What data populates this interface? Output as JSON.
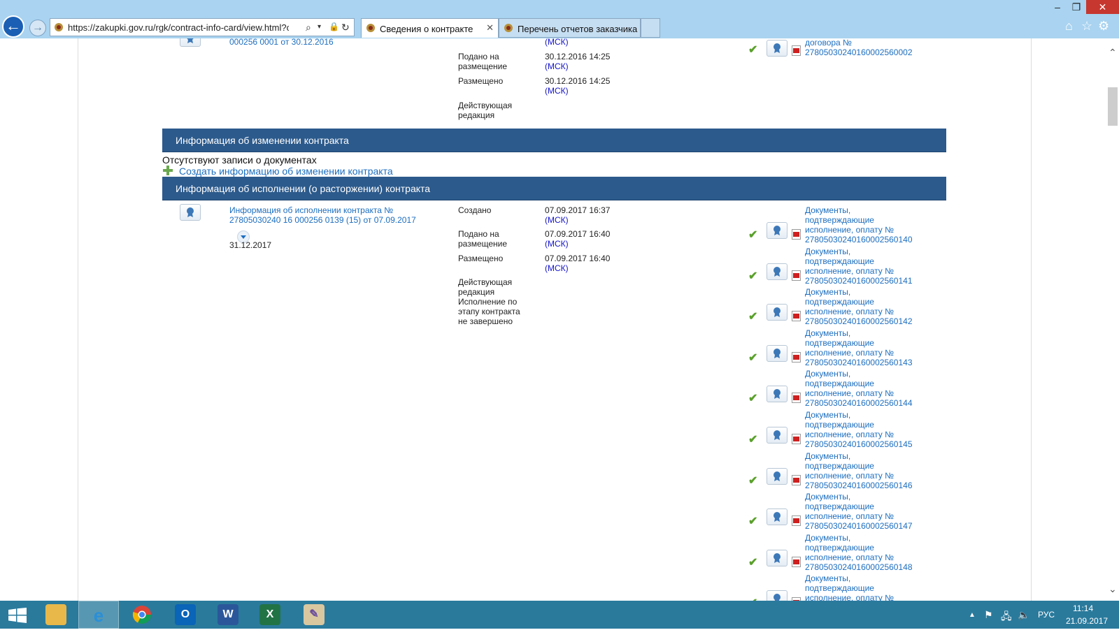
{
  "browser": {
    "url": "https://zakupki.gov.ru/rgk/contract-info-card/view.html?contrac",
    "tabs": [
      {
        "label": "Сведения о контракте"
      },
      {
        "label": "Перечень отчетов заказчика"
      }
    ],
    "tab_close_glyph": "✕",
    "window_controls": {
      "minimize": "–",
      "restore": "❐",
      "close": "✕"
    }
  },
  "page": {
    "top_block": {
      "contract_link_tail": "000256 0001 от 30.12.2016",
      "msk_1": "(МСК)",
      "rows": [
        {
          "label": "Подано на размещение",
          "value": "30.12.2016 14:25",
          "msk": "(МСК)"
        },
        {
          "label": "Размещено",
          "value": "30.12.2016 14:25",
          "msk": "(МСК)"
        },
        {
          "label": "Действующая редакция"
        }
      ],
      "doc_link_line1": "договора №",
      "doc_link_line2": "27805030240160002560002"
    },
    "change_section": {
      "title": "Информация об изменении контракта",
      "empty_note": "Отсутствуют записи о документах",
      "create_link": "Создать информацию об изменении контракта"
    },
    "execution_section": {
      "title": "Информация об исполнении (о расторжении) контракта",
      "record_link": "Информация об исполнении контракта № 27805030240 16 000256 0139 (15) от 07.09.2017",
      "record_date": "31.12.2017",
      "fields": [
        {
          "label": "Создано",
          "value": "07.09.2017 16:37",
          "msk": "(МСК)"
        },
        {
          "label": "Подано на размещение",
          "value": "07.09.2017 16:40",
          "msk": "(МСК)"
        },
        {
          "label": "Размещено",
          "value": "07.09.2017 16:40",
          "msk": "(МСК)"
        },
        {
          "label": "Действующая редакция"
        },
        {
          "label": "Исполнение по этапу контракта не завершено"
        }
      ],
      "documents": [
        {
          "l1": "Документы,",
          "l2": "подтверждающие",
          "l3": "исполнение, оплату №",
          "num": "27805030240160002560140"
        },
        {
          "l1": "Документы,",
          "l2": "подтверждающие",
          "l3": "исполнение, оплату №",
          "num": "27805030240160002560141"
        },
        {
          "l1": "Документы,",
          "l2": "подтверждающие",
          "l3": "исполнение, оплату №",
          "num": "27805030240160002560142"
        },
        {
          "l1": "Документы,",
          "l2": "подтверждающие",
          "l3": "исполнение, оплату №",
          "num": "27805030240160002560143"
        },
        {
          "l1": "Документы,",
          "l2": "подтверждающие",
          "l3": "исполнение, оплату №",
          "num": "27805030240160002560144"
        },
        {
          "l1": "Документы,",
          "l2": "подтверждающие",
          "l3": "исполнение, оплату №",
          "num": "27805030240160002560145"
        },
        {
          "l1": "Документы,",
          "l2": "подтверждающие",
          "l3": "исполнение, оплату №",
          "num": "27805030240160002560146"
        },
        {
          "l1": "Документы,",
          "l2": "подтверждающие",
          "l3": "исполнение, оплату №",
          "num": "27805030240160002560147"
        },
        {
          "l1": "Документы,",
          "l2": "подтверждающие",
          "l3": "исполнение, оплату №",
          "num": "27805030240160002560148"
        },
        {
          "l1": "Документы,",
          "l2": "подтверждающие",
          "l3": "исполнение, оплату №",
          "num": ""
        }
      ]
    }
  },
  "taskbar": {
    "apps": [
      "windows-start",
      "file-explorer",
      "internet-explorer",
      "chrome",
      "outlook",
      "word",
      "excel",
      "paint"
    ],
    "language": "РУС",
    "time": "11:14",
    "date": "21.09.2017"
  }
}
